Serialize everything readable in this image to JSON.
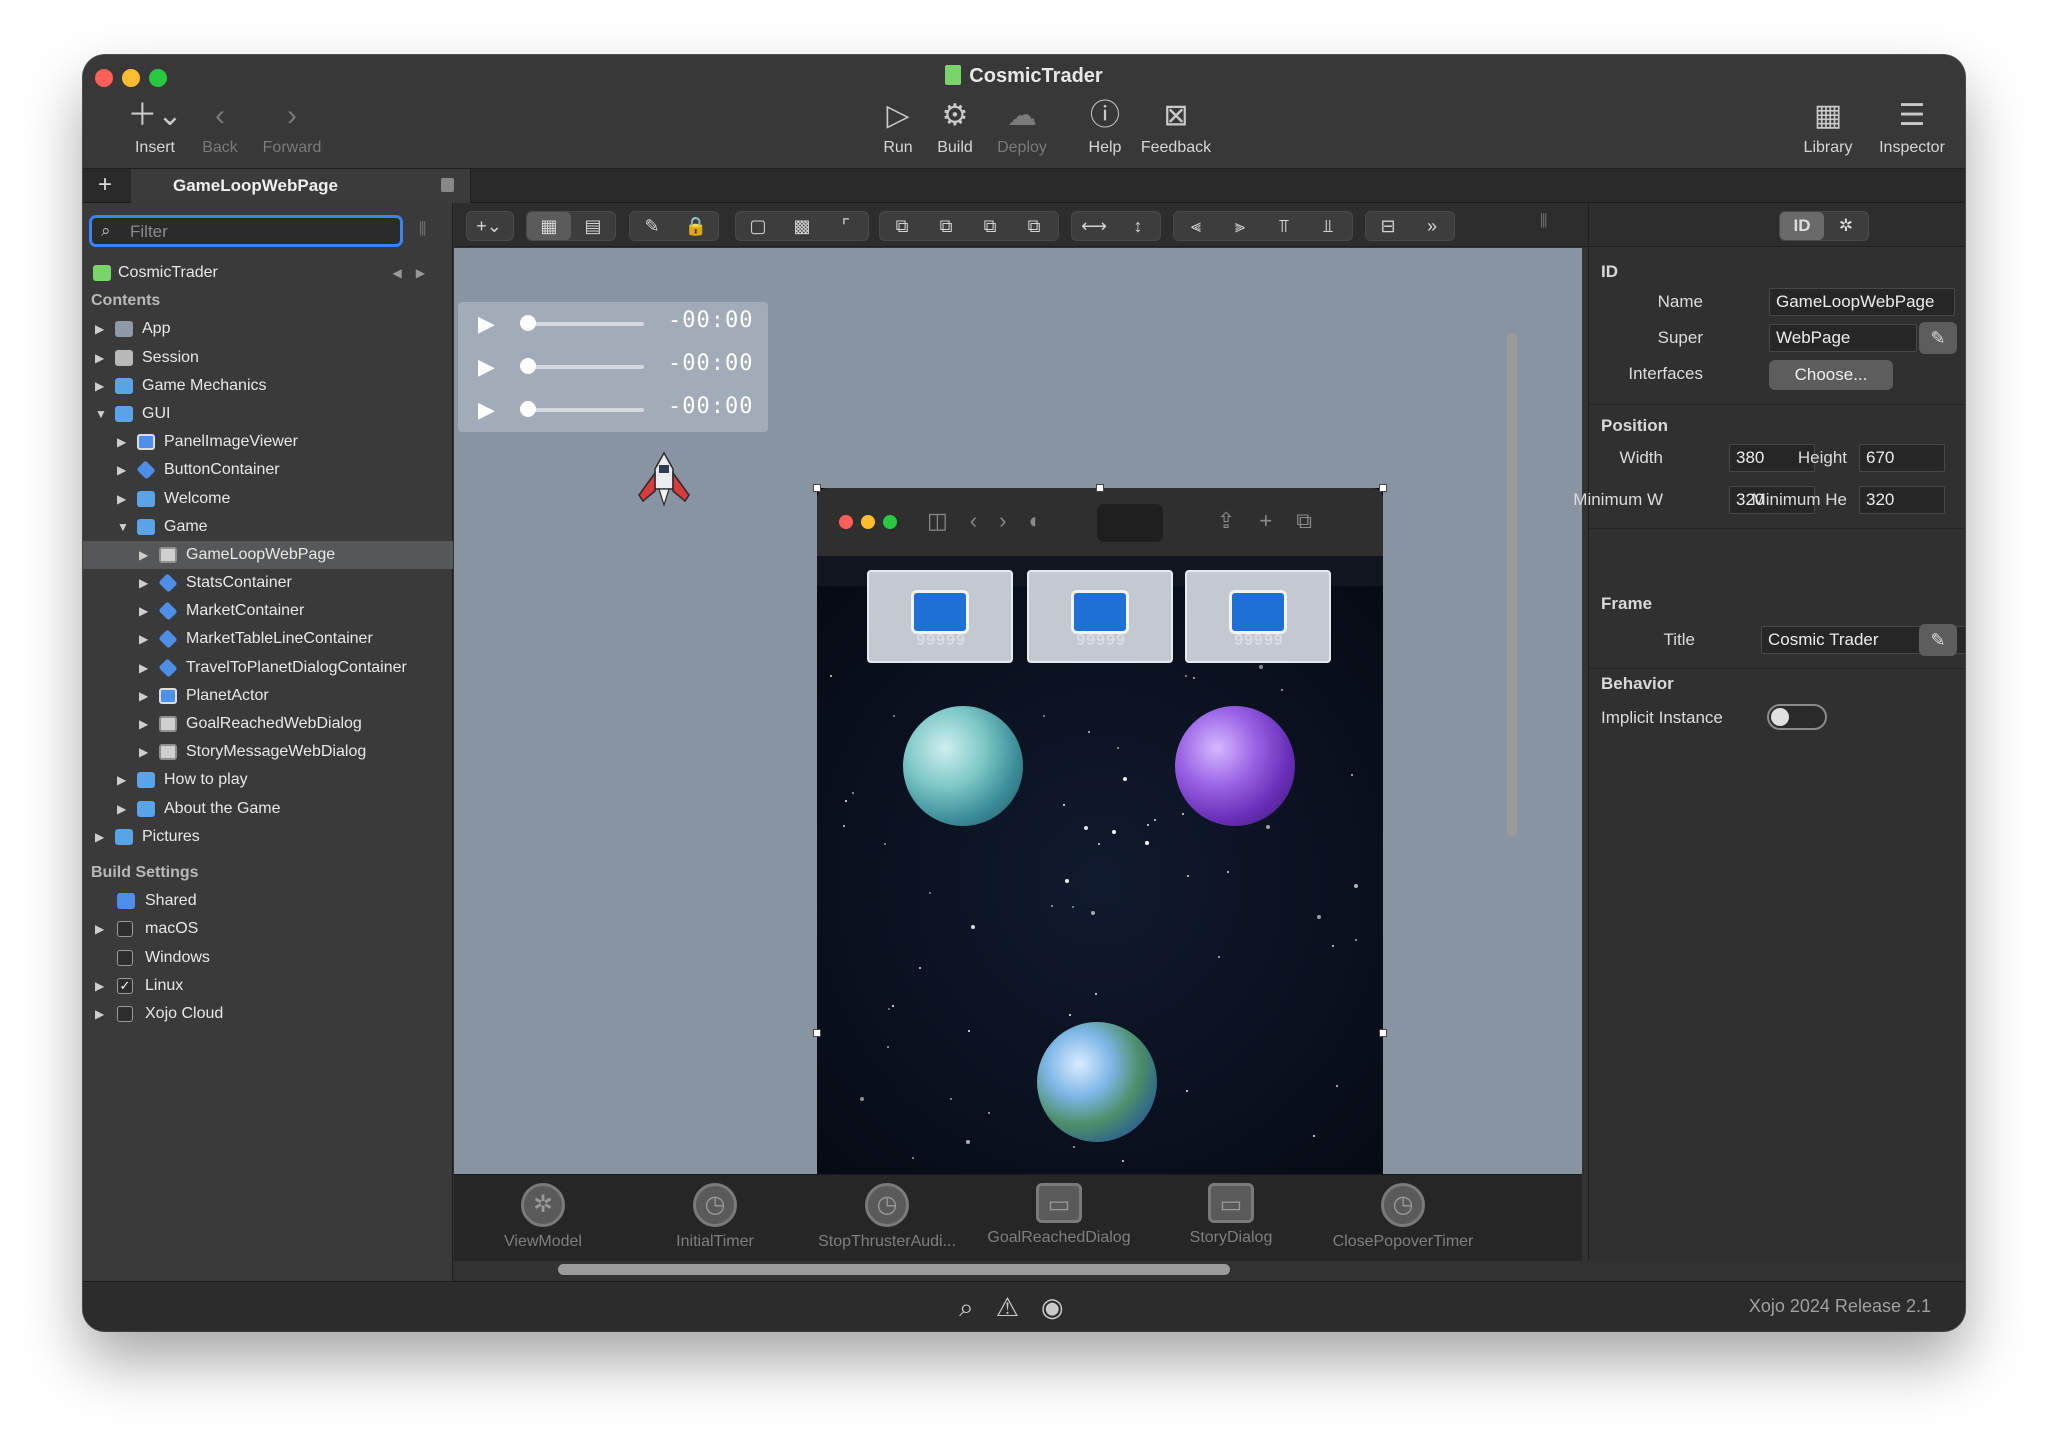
{
  "window": {
    "title": "CosmicTrader"
  },
  "toolbar": {
    "insert": "Insert",
    "back": "Back",
    "forward": "Forward",
    "run": "Run",
    "build": "Build",
    "deploy": "Deploy",
    "help": "Help",
    "feedback": "Feedback",
    "library": "Library",
    "inspector": "Inspector"
  },
  "tabs": {
    "active": "GameLoopWebPage"
  },
  "navigator": {
    "filter_placeholder": "Filter",
    "project": "CosmicTrader",
    "contents_header": "Contents",
    "items": [
      {
        "label": "App",
        "level": 0,
        "icon": "app-icon",
        "expanded": false
      },
      {
        "label": "Session",
        "level": 0,
        "icon": "session-icon",
        "expanded": false
      },
      {
        "label": "Game Mechanics",
        "level": 0,
        "icon": "folder-icon",
        "expanded": false
      },
      {
        "label": "GUI",
        "level": 0,
        "icon": "folder-icon",
        "expanded": true
      },
      {
        "label": "PanelImageViewer",
        "level": 1,
        "icon": "window-icon",
        "expanded": false
      },
      {
        "label": "ButtonContainer",
        "level": 1,
        "icon": "container-icon",
        "expanded": false
      },
      {
        "label": "Welcome",
        "level": 1,
        "icon": "folder-icon",
        "expanded": false
      },
      {
        "label": "Game",
        "level": 1,
        "icon": "folder-icon",
        "expanded": true
      },
      {
        "label": "GameLoopWebPage",
        "level": 2,
        "icon": "webpage-icon",
        "expanded": false
      },
      {
        "label": "StatsContainer",
        "level": 2,
        "icon": "container-icon",
        "expanded": false
      },
      {
        "label": "MarketContainer",
        "level": 2,
        "icon": "container-icon",
        "expanded": false
      },
      {
        "label": "MarketTableLineContainer",
        "level": 2,
        "icon": "container-icon",
        "expanded": false
      },
      {
        "label": "TravelToPlanetDialogContainer",
        "level": 2,
        "icon": "container-icon",
        "expanded": false
      },
      {
        "label": "PlanetActor",
        "level": 2,
        "icon": "window-icon",
        "expanded": false
      },
      {
        "label": "GoalReachedWebDialog",
        "level": 2,
        "icon": "webpage-icon",
        "expanded": false
      },
      {
        "label": "StoryMessageWebDialog",
        "level": 2,
        "icon": "webpage-icon",
        "expanded": false
      },
      {
        "label": "How to play",
        "level": 1,
        "icon": "folder-icon",
        "expanded": false
      },
      {
        "label": "About the Game",
        "level": 1,
        "icon": "folder-icon",
        "expanded": false
      },
      {
        "label": "Pictures",
        "level": 0,
        "icon": "folder-icon",
        "expanded": false
      }
    ],
    "selected": "GameLoopWebPage",
    "build_header": "Build Settings",
    "build_items": [
      {
        "label": "Shared",
        "checked": null,
        "has_arrow": false
      },
      {
        "label": "macOS",
        "checked": false,
        "has_arrow": true
      },
      {
        "label": "Windows",
        "checked": false,
        "has_arrow": false
      },
      {
        "label": "Linux",
        "checked": true,
        "has_arrow": true
      },
      {
        "label": "Xojo Cloud",
        "checked": false,
        "has_arrow": true
      }
    ]
  },
  "canvas": {
    "audio_players": [
      {
        "time": "-00:00"
      },
      {
        "time": "-00:00"
      },
      {
        "time": "-00:00"
      }
    ],
    "slot_labels": [
      "99999",
      "99999",
      "99999"
    ]
  },
  "tray": {
    "items": [
      {
        "label": "ViewModel",
        "icon": "gear-icon",
        "kind": "circle"
      },
      {
        "label": "InitialTimer",
        "icon": "timer-icon",
        "kind": "circle"
      },
      {
        "label": "StopThrusterAudi...",
        "icon": "timer-icon",
        "kind": "circle"
      },
      {
        "label": "GoalReachedDialog",
        "icon": "dialog-icon",
        "kind": "dialog"
      },
      {
        "label": "StoryDialog",
        "icon": "dialog-icon",
        "kind": "dialog"
      },
      {
        "label": "ClosePopoverTimer",
        "icon": "timer-icon",
        "kind": "circle"
      }
    ]
  },
  "inspector": {
    "toggle_id": "ID",
    "id_header": "ID",
    "name_label": "Name",
    "name_value": "GameLoopWebPage",
    "super_label": "Super",
    "super_value": "WebPage",
    "interfaces_label": "Interfaces",
    "choose_button": "Choose...",
    "position_header": "Position",
    "width_label": "Width",
    "width_value": "380",
    "height_label": "Height",
    "height_value": "670",
    "minw_label": "Minimum W",
    "minw_value": "320",
    "minh_label": "Minimum He",
    "minh_value": "320",
    "frame_header": "Frame",
    "title_label": "Title",
    "title_value": "Cosmic Trader",
    "behavior_header": "Behavior",
    "implicit_label": "Implicit Instance",
    "implicit_value": false
  },
  "status": {
    "version": "Xojo 2024 Release 2.1"
  }
}
